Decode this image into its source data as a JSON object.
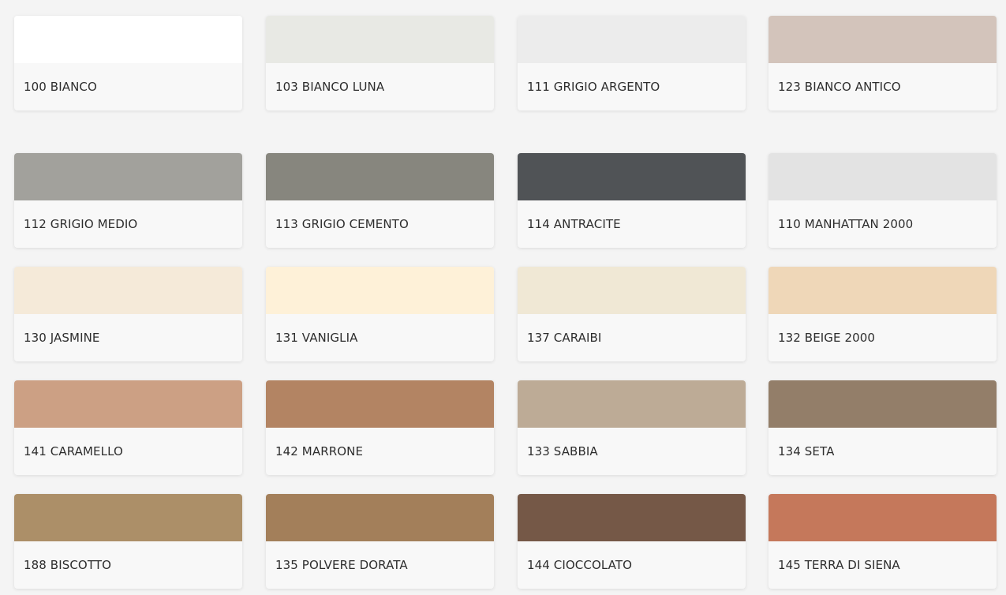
{
  "swatches": [
    {
      "label": "100 BIANCO",
      "color": "#ffffff"
    },
    {
      "label": "103 BIANCO LUNA",
      "color": "#e8e9e4"
    },
    {
      "label": "111 GRIGIO ARGENTO",
      "color": "#ececec"
    },
    {
      "label": "123 BIANCO ANTICO",
      "color": "#d3c4bb"
    },
    {
      "label": "112 GRIGIO MEDIO",
      "color": "#a2a19c"
    },
    {
      "label": "113 GRIGIO CEMENTO",
      "color": "#87867e"
    },
    {
      "label": "114 ANTRACITE",
      "color": "#505356"
    },
    {
      "label": "110 MANHATTAN 2000",
      "color": "#e3e3e3"
    },
    {
      "label": "130 JASMINE",
      "color": "#f5ead9"
    },
    {
      "label": "131 VANIGLIA",
      "color": "#fef1d8"
    },
    {
      "label": "137 CARAIBI",
      "color": "#f0e8d5"
    },
    {
      "label": "132 BEIGE 2000",
      "color": "#efd7b8"
    },
    {
      "label": "141 CARAMELLO",
      "color": "#cca084"
    },
    {
      "label": "142 MARRONE",
      "color": "#b38463"
    },
    {
      "label": "133 SABBIA",
      "color": "#bdab96"
    },
    {
      "label": "134 SETA",
      "color": "#937e69"
    },
    {
      "label": "188 BISCOTTO",
      "color": "#ac8f68"
    },
    {
      "label": "135 POLVERE DORATA",
      "color": "#a37f5a"
    },
    {
      "label": "144 CIOCCOLATO",
      "color": "#755847"
    },
    {
      "label": "145 TERRA DI SIENA",
      "color": "#c5785b"
    }
  ]
}
